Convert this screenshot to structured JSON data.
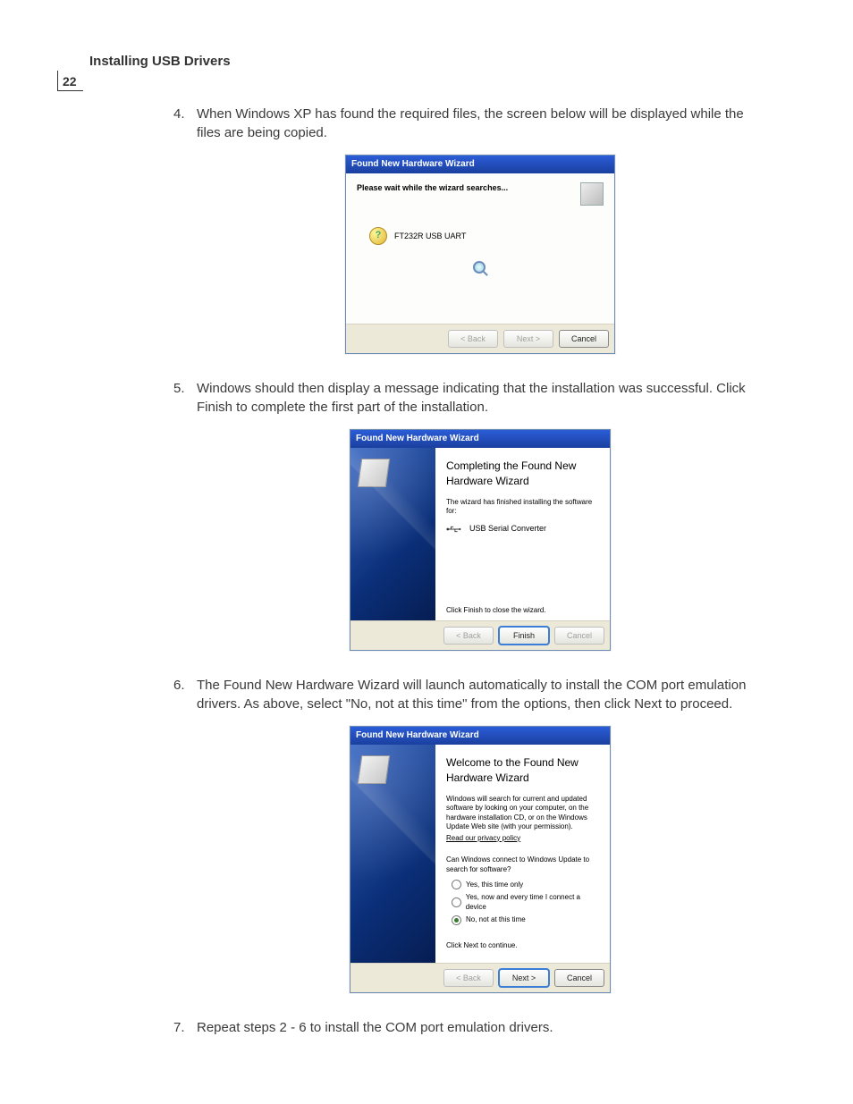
{
  "header": {
    "section_title": "Installing USB Drivers",
    "page_number": "22"
  },
  "steps": [
    {
      "num": "4.",
      "text": "When Windows XP has found the required files, the screen below will be displayed while the files are being copied."
    },
    {
      "num": "5.",
      "text": "Windows should then display a message indicating that the installation was successful. Click Finish to complete the first part of the installation."
    },
    {
      "num": "6.",
      "text": "The Found New Hardware Wizard will launch automatically to install the COM port emulation drivers.  As above, select \"No, not at this time\" from the options, then click Next to proceed."
    },
    {
      "num": "7.",
      "text": "Repeat steps 2 - 6 to install the COM port emulation drivers."
    }
  ],
  "dialog1": {
    "title": "Found New Hardware Wizard",
    "subtitle": "Please wait while the wizard searches...",
    "device": "FT232R USB UART",
    "buttons": {
      "back": "< Back",
      "next": "Next >",
      "cancel": "Cancel"
    }
  },
  "dialog2": {
    "title": "Found New Hardware Wizard",
    "heading": "Completing the Found New Hardware Wizard",
    "installed_text": "The wizard has finished installing the software for:",
    "device": "USB Serial Converter",
    "hint": "Click Finish to close the wizard.",
    "buttons": {
      "back": "< Back",
      "finish": "Finish",
      "cancel": "Cancel"
    }
  },
  "dialog3": {
    "title": "Found New Hardware Wizard",
    "heading": "Welcome to the Found New Hardware Wizard",
    "intro": "Windows will search for current and updated software by looking on your computer, on the hardware installation CD, or on the Windows Update Web site (with your permission).",
    "privacy_link": "Read our privacy policy",
    "question": "Can Windows connect to Windows Update to search for software?",
    "options": {
      "opt1": "Yes, this time only",
      "opt2": "Yes, now and every time I connect a device",
      "opt3": "No, not at this time"
    },
    "hint": "Click Next to continue.",
    "buttons": {
      "back": "< Back",
      "next": "Next >",
      "cancel": "Cancel"
    }
  }
}
